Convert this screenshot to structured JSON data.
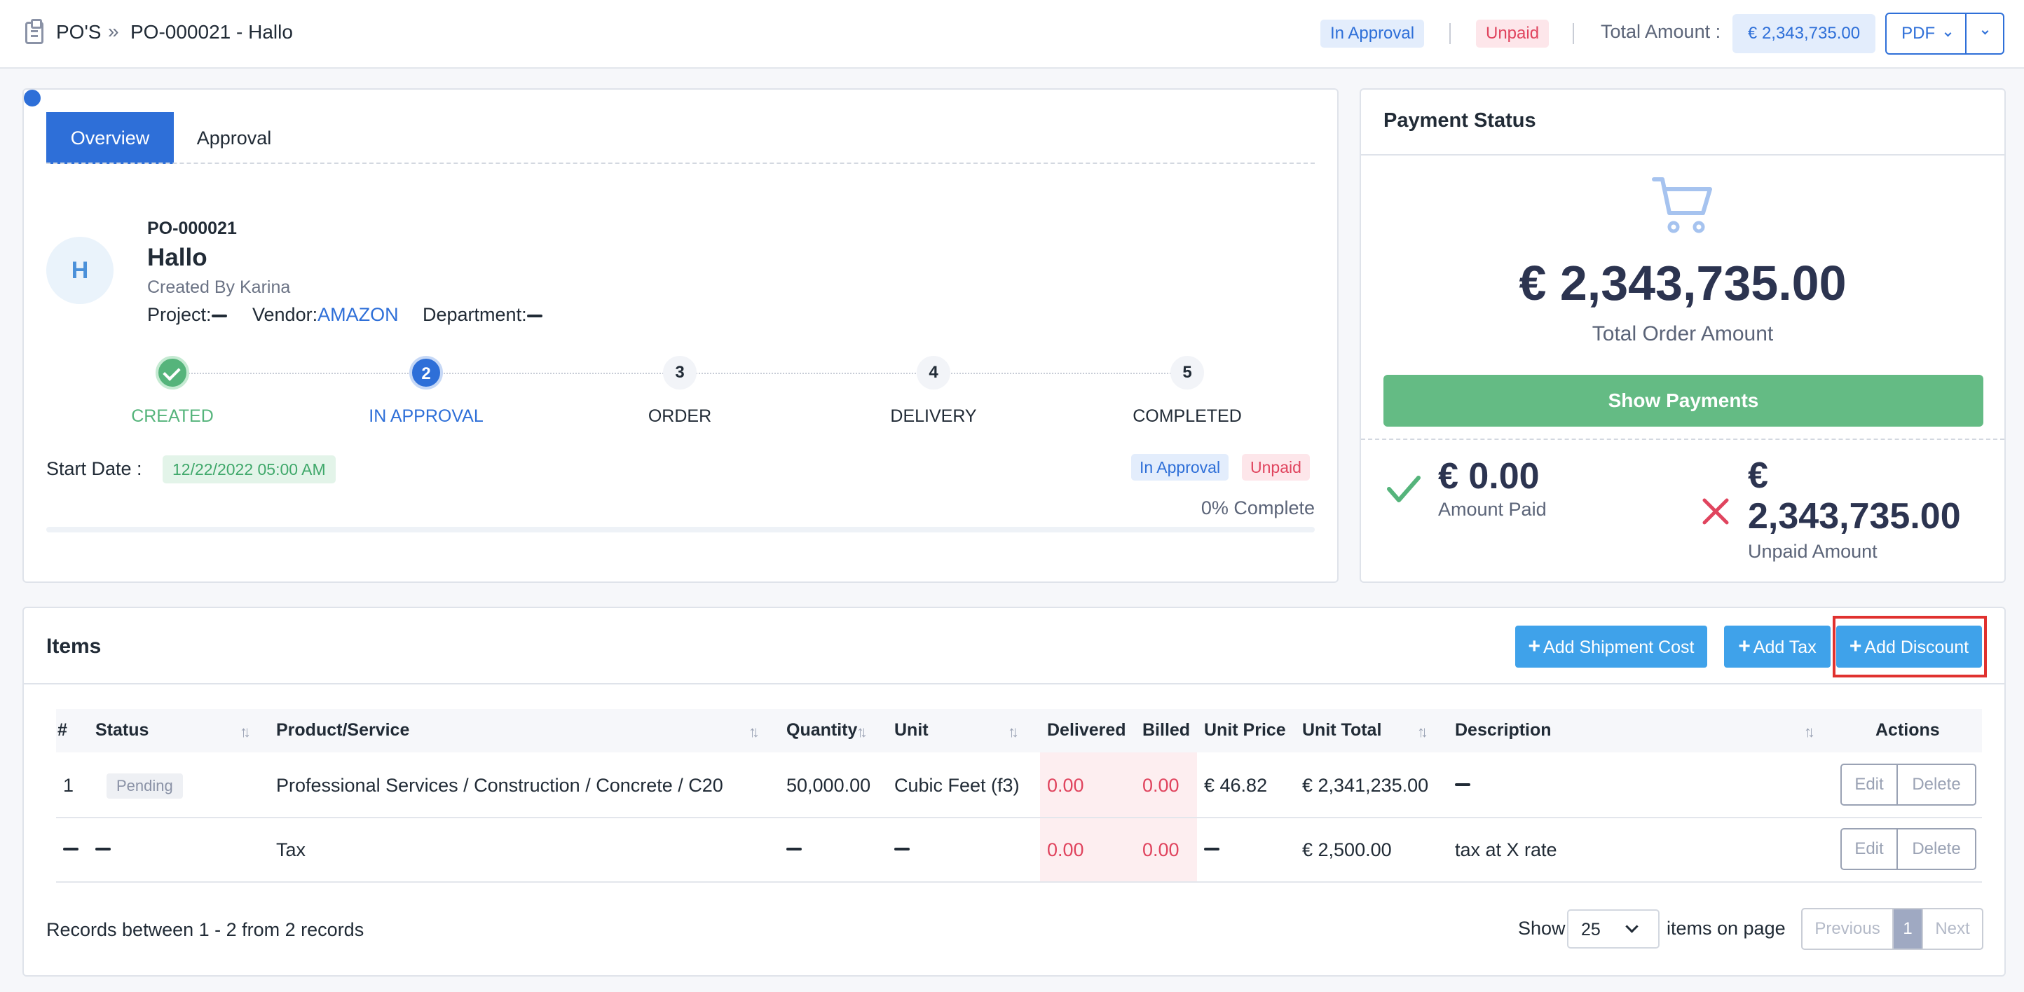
{
  "breadcrumb": {
    "root": "PO'S",
    "separator": "»",
    "current": "PO-000021 - Hallo"
  },
  "header": {
    "status_badge": "In Approval",
    "payment_badge": "Unpaid",
    "total_label": "Total Amount :",
    "total_value": "€ 2,343,735.00",
    "pdf_label": "PDF"
  },
  "tabs": [
    {
      "label": "Overview",
      "active": true
    },
    {
      "label": "Approval",
      "active": false
    }
  ],
  "po": {
    "avatar_letter": "H",
    "number": "PO-000021",
    "title": "Hallo",
    "created_by": "Created By Karina",
    "project_label": "Project:",
    "vendor_label": "Vendor:",
    "vendor_value": "AMAZON",
    "department_label": "Department:"
  },
  "steps": [
    {
      "number": "1",
      "label": "CREATED",
      "state": "done"
    },
    {
      "number": "2",
      "label": "IN APPROVAL",
      "state": "current"
    },
    {
      "number": "3",
      "label": "ORDER",
      "state": "todo"
    },
    {
      "number": "4",
      "label": "DELIVERY",
      "state": "todo"
    },
    {
      "number": "5",
      "label": "COMPLETED",
      "state": "todo"
    }
  ],
  "overview": {
    "start_label": "Start Date :",
    "start_value": "12/22/2022 05:00 AM",
    "status_badge": "In Approval",
    "payment_badge": "Unpaid",
    "percent_complete": "0% Complete",
    "progress_fraction": 0
  },
  "payment": {
    "title": "Payment Status",
    "total_amount": "€ 2,343,735.00",
    "total_label": "Total Order Amount",
    "show_payments": "Show Payments",
    "paid_amount": "€ 0.00",
    "paid_label": "Amount Paid",
    "unpaid_amount": "€ 2,343,735.00",
    "unpaid_label": "Unpaid Amount"
  },
  "items": {
    "title": "Items",
    "add_shipment": "Add Shipment Cost",
    "add_tax": "Add Tax",
    "add_discount": "Add Discount",
    "columns": {
      "num": "#",
      "status": "Status",
      "product": "Product/Service",
      "quantity": "Quantity",
      "unit": "Unit",
      "delivered": "Delivered",
      "billed": "Billed",
      "unit_price": "Unit Price",
      "unit_total": "Unit Total",
      "description": "Description",
      "actions": "Actions"
    },
    "rows": [
      {
        "num": "1",
        "status": "Pending",
        "product": "Professional Services / Construction / Concrete / C20",
        "quantity": "50,000.00",
        "unit": "Cubic Feet (f3)",
        "delivered": "0.00",
        "billed": "0.00",
        "unit_price": "€ 46.82",
        "unit_total": "€ 2,341,235.00",
        "description": "",
        "edit": "Edit",
        "delete": "Delete"
      },
      {
        "num": "",
        "status": "",
        "product": "Tax",
        "quantity": "",
        "unit": "",
        "delivered": "0.00",
        "billed": "0.00",
        "unit_price": "",
        "unit_total": "€ 2,500.00",
        "description": "tax at X rate",
        "edit": "Edit",
        "delete": "Delete"
      }
    ]
  },
  "pagination": {
    "records_text": "Records between 1 - 2 from 2 records",
    "show_label": "Show",
    "page_size": "25",
    "items_on_page": "items on page",
    "previous": "Previous",
    "current_page": "1",
    "next": "Next"
  },
  "colors": {
    "primary": "#2e6fd8",
    "success": "#64bb84",
    "danger": "#e0445e",
    "button_blue": "#3fa2ea",
    "highlight_border": "#e0312f"
  }
}
